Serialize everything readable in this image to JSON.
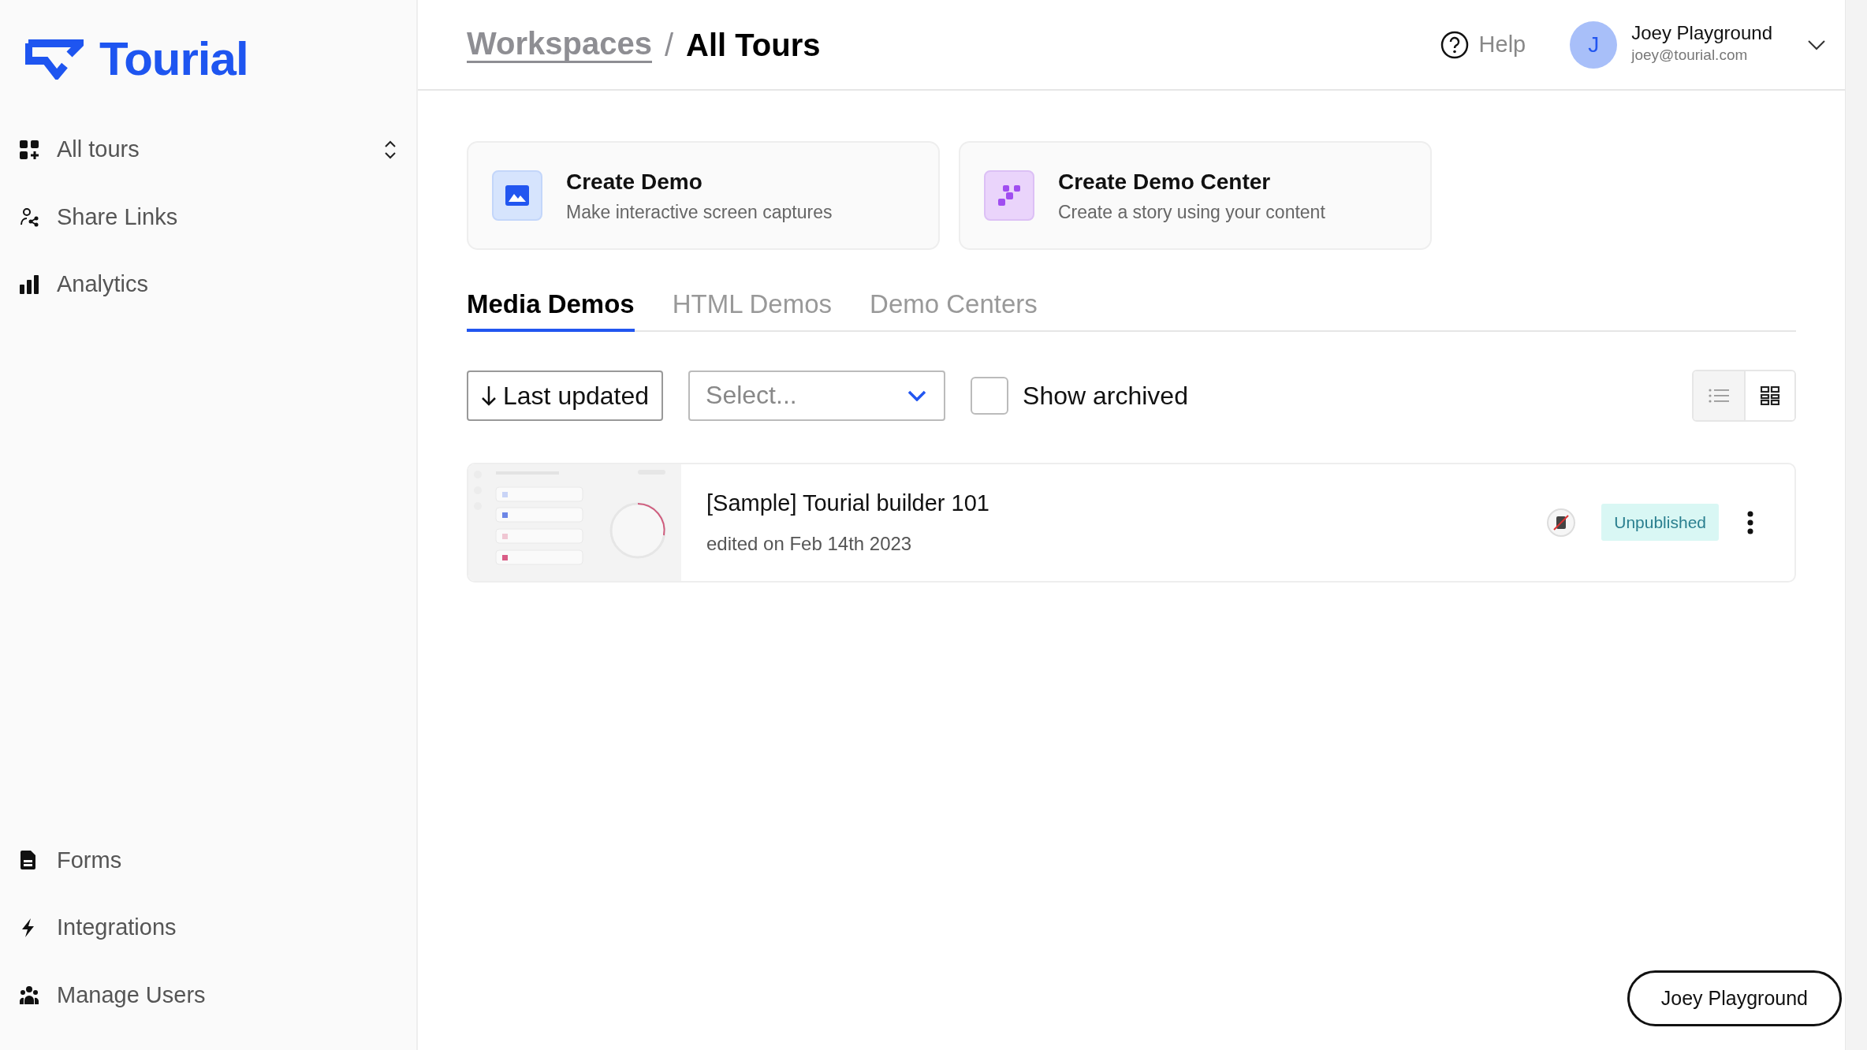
{
  "logo": {
    "text": "Tourial"
  },
  "sidebar": {
    "top_items": [
      {
        "label": "All tours",
        "kind": "switcher"
      },
      {
        "label": "Share Links",
        "kind": "link"
      },
      {
        "label": "Analytics",
        "kind": "link"
      }
    ],
    "bottom_items": [
      {
        "label": "Forms",
        "kind": "link"
      },
      {
        "label": "Integrations",
        "kind": "link"
      },
      {
        "label": "Manage Users",
        "kind": "link"
      }
    ]
  },
  "header": {
    "breadcrumbs": [
      {
        "label": "Workspaces",
        "kind": "link"
      },
      {
        "label": "All Tours",
        "kind": "current"
      }
    ],
    "separator": "/",
    "help": {
      "label": "Help"
    },
    "user": {
      "initial": "J",
      "name": "Joey Playground",
      "email": "joey@tourial.com"
    }
  },
  "create_cards": [
    {
      "kind": "demo",
      "title": "Create Demo",
      "subtitle": "Make interactive screen captures"
    },
    {
      "kind": "center",
      "title": "Create Demo Center",
      "subtitle": "Create a story using your content"
    }
  ],
  "tabs": [
    {
      "label": "Media Demos",
      "selected": true
    },
    {
      "label": "HTML Demos",
      "selected": false
    },
    {
      "label": "Demo Centers",
      "selected": false
    }
  ],
  "toolbar": {
    "sort": {
      "label": "Last updated"
    },
    "filter": {
      "placeholder": "Select..."
    },
    "show_archived": {
      "label": "Show archived",
      "checked": false
    },
    "views": [
      {
        "kind": "list",
        "selected": false
      },
      {
        "kind": "grid",
        "selected": true
      }
    ]
  },
  "demos": [
    {
      "title": "[Sample] Tourial builder 101",
      "edited": "edited on Feb 14th 2023",
      "status": "Unpublished"
    }
  ],
  "footer_button": {
    "label": "Joey Playground"
  }
}
